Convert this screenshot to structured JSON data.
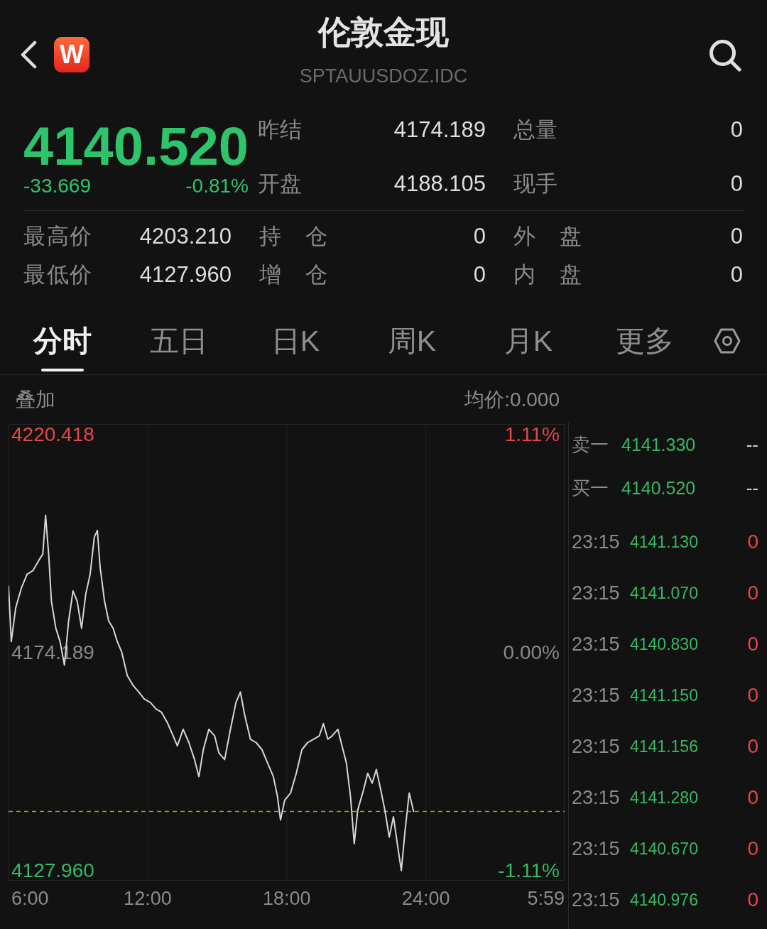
{
  "header": {
    "logo": "W",
    "title": "伦敦金现",
    "subtitle": "SPTAUUSDOZ.IDC"
  },
  "quote": {
    "price": "4140.520",
    "change": "-33.669",
    "change_percent": "-0.81%"
  },
  "upper_stats": [
    {
      "label": "昨结",
      "value": "4174.189"
    },
    {
      "label": "总量",
      "value": "0"
    },
    {
      "label": "开盘",
      "value": "4188.105"
    },
    {
      "label": "现手",
      "value": "0"
    }
  ],
  "lower_stats": [
    {
      "label": "最高价",
      "value": "4203.210"
    },
    {
      "label": "持 仓",
      "value": "0"
    },
    {
      "label": "外 盘",
      "value": "0"
    },
    {
      "label": "最低价",
      "value": "4127.960"
    },
    {
      "label": "增 仓",
      "value": "0"
    },
    {
      "label": "内 盘",
      "value": "0"
    }
  ],
  "tabs": [
    {
      "label": "分时",
      "selected": true
    },
    {
      "label": "五日",
      "selected": false
    },
    {
      "label": "日K",
      "selected": false
    },
    {
      "label": "周K",
      "selected": false
    },
    {
      "label": "月K",
      "selected": false
    },
    {
      "label": "更多",
      "selected": false
    }
  ],
  "chart": {
    "overlay": "叠加",
    "average": "均价:0.000",
    "percent_ticks": [
      "1.11%",
      "0.00%",
      "-1.11%"
    ],
    "session_start": "6:00",
    "session_end": "5:59",
    "chart_data": {
      "type": "line",
      "x": [
        6.0,
        6.12,
        6.31,
        6.56,
        6.8,
        7.05,
        7.3,
        7.48,
        7.6,
        7.73,
        7.85,
        8.04,
        8.22,
        8.41,
        8.59,
        8.78,
        8.96,
        9.15,
        9.33,
        9.52,
        9.7,
        9.83,
        9.95,
        10.14,
        10.32,
        10.51,
        10.69,
        10.88,
        11.12,
        11.37,
        11.62,
        11.86,
        12.11,
        12.36,
        12.6,
        12.85,
        13.1,
        13.28,
        13.53,
        13.78,
        14.02,
        14.21,
        14.4,
        14.64,
        14.89,
        15.07,
        15.32,
        15.57,
        15.81,
        16.0,
        16.19,
        16.43,
        16.68,
        16.93,
        17.17,
        17.42,
        17.6,
        17.73,
        17.91,
        18.16,
        18.41,
        18.65,
        18.9,
        19.15,
        19.4,
        19.58,
        19.77,
        19.95,
        20.2,
        20.38,
        20.57,
        20.75,
        20.91,
        21.06,
        21.31,
        21.49,
        21.68,
        21.86,
        22.05,
        22.23,
        22.42,
        22.6,
        22.79,
        22.94,
        23.1,
        23.28,
        23.47
      ],
      "values": [
        4188.2,
        4176.5,
        4183.6,
        4187.9,
        4190.7,
        4191.5,
        4193.6,
        4195.0,
        4203.2,
        4195.0,
        4185.0,
        4179.3,
        4176.5,
        4171.5,
        4180.8,
        4187.2,
        4185.0,
        4179.3,
        4186.5,
        4190.7,
        4198.6,
        4200.0,
        4192.2,
        4185.0,
        4180.8,
        4179.3,
        4176.5,
        4174.3,
        4169.3,
        4167.2,
        4165.8,
        4164.3,
        4163.6,
        4162.2,
        4161.5,
        4159.3,
        4156.5,
        4154.4,
        4157.9,
        4155.1,
        4151.5,
        4147.9,
        4153.6,
        4157.9,
        4156.5,
        4152.9,
        4151.5,
        4157.9,
        4163.6,
        4165.8,
        4160.8,
        4155.8,
        4155.1,
        4153.6,
        4150.8,
        4147.9,
        4143.6,
        4138.7,
        4142.9,
        4144.4,
        4148.6,
        4153.6,
        4155.1,
        4155.8,
        4156.5,
        4159.1,
        4155.8,
        4156.5,
        4157.9,
        4154.4,
        4150.8,
        4143.6,
        4133.7,
        4140.8,
        4145.1,
        4148.6,
        4146.5,
        4149.4,
        4145.1,
        4140.8,
        4135.1,
        4139.4,
        4132.9,
        4128.0,
        4136.5,
        4144.4,
        4140.5
      ],
      "xlim": [
        6,
        29.98
      ],
      "ylim": [
        4125.855,
        4222.523
      ],
      "grid": true,
      "xticks": [
        {
          "value": 12,
          "label": "12:00"
        },
        {
          "value": 18,
          "label": "18:00"
        },
        {
          "value": 24,
          "label": "24:00"
        }
      ],
      "yticks": [
        {
          "value": 4220.418,
          "label": "4220.418"
        },
        {
          "value": 4174.189,
          "label": "4174.189"
        },
        {
          "value": 4127.96,
          "label": "4127.960"
        }
      ],
      "ref_lines": [
        {
          "axis": "y",
          "value": 4140.52
        }
      ]
    }
  },
  "order_book": [
    {
      "label": "卖一",
      "price": "4141.330",
      "volume": "--"
    },
    {
      "label": "买一",
      "price": "4140.520",
      "volume": "--"
    }
  ],
  "trades": [
    {
      "time": "23:15",
      "price": "4141.130",
      "volume": "0"
    },
    {
      "time": "23:15",
      "price": "4141.070",
      "volume": "0"
    },
    {
      "time": "23:15",
      "price": "4140.830",
      "volume": "0"
    },
    {
      "time": "23:15",
      "price": "4141.150",
      "volume": "0"
    },
    {
      "time": "23:15",
      "price": "4141.156",
      "volume": "0"
    },
    {
      "time": "23:15",
      "price": "4141.280",
      "volume": "0"
    },
    {
      "time": "23:15",
      "price": "4140.670",
      "volume": "0"
    },
    {
      "time": "23:15",
      "price": "4140.976",
      "volume": "0"
    }
  ]
}
